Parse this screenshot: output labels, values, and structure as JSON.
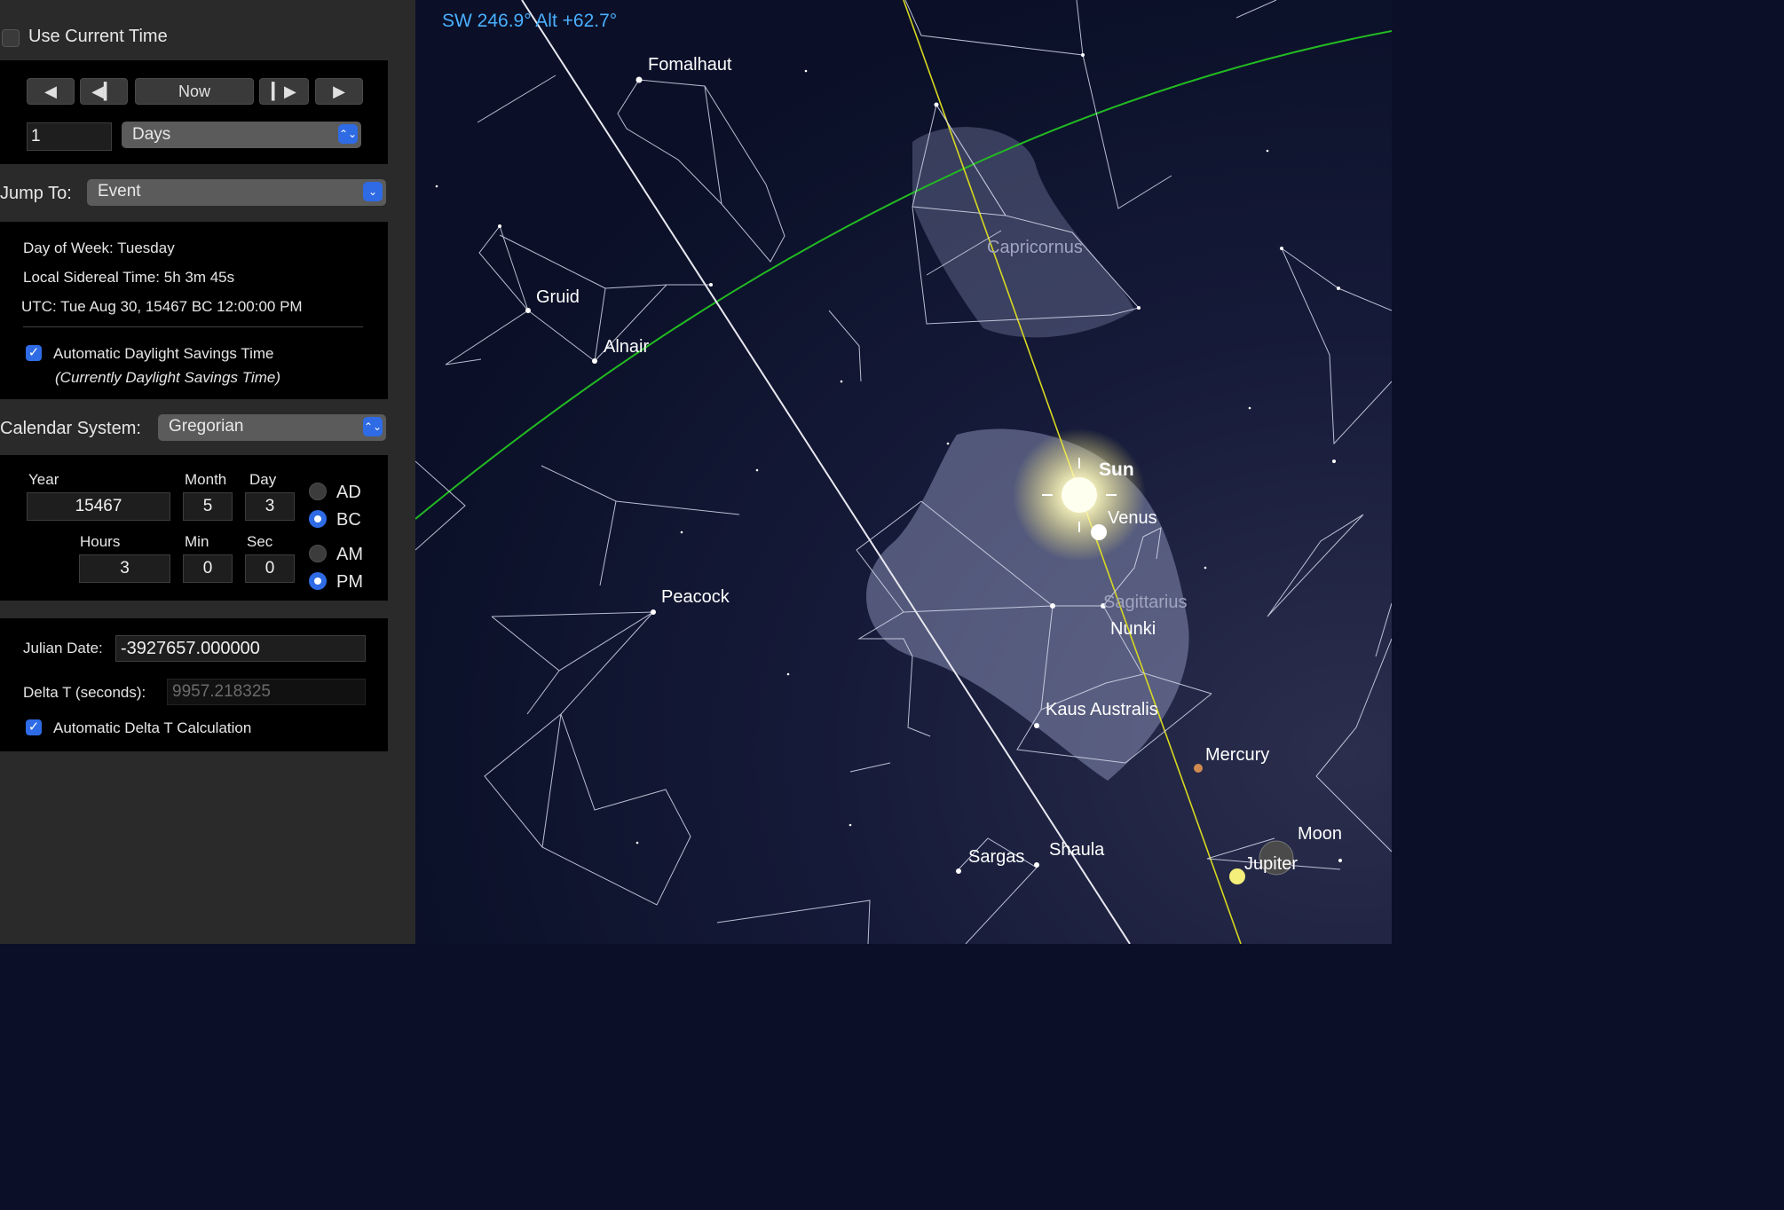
{
  "controls": {
    "use_current_time_label": "Use Current Time",
    "use_current_time_checked": false,
    "now_label": "Now",
    "step_value": "1",
    "step_unit": "Days",
    "jump_to_label": "Jump To:",
    "jump_to_value": "Event"
  },
  "info": {
    "day_of_week": "Day of Week:  Tuesday",
    "sidereal": "Local Sidereal Time:  5h 3m 45s",
    "utc": "UTC:  Tue Aug 30, 15467 BC 12:00:00 PM",
    "auto_dst_label": "Automatic Daylight Savings Time",
    "auto_dst_checked": true,
    "dst_note": "(Currently Daylight Savings Time)"
  },
  "calendar": {
    "label": "Calendar System:",
    "value": "Gregorian",
    "year_label": "Year",
    "year": "15467",
    "month_label": "Month",
    "month": "5",
    "day_label": "Day",
    "day": "3",
    "hours_label": "Hours",
    "hours": "3",
    "min_label": "Min",
    "min": "0",
    "sec_label": "Sec",
    "sec": "0",
    "ad_label": "AD",
    "bc_label": "BC",
    "era_selected": "BC",
    "am_label": "AM",
    "pm_label": "PM",
    "ampm_selected": "PM"
  },
  "julian": {
    "label": "Julian Date:",
    "value": "-3927657.000000",
    "delta_t_label": "Delta T (seconds):",
    "delta_t_value": "9957.218325",
    "auto_delta_label": "Automatic Delta T Calculation",
    "auto_delta_checked": true
  },
  "sky": {
    "direction": "SW 246.9° Alt +62.7°",
    "colors": {
      "ecliptic": "#22bb22",
      "meridian": "#d8d820",
      "direction_text": "#4ab0ff",
      "label": "#ffffff"
    },
    "star_labels": [
      "Fomalhaut",
      "Gruid",
      "Alnair",
      "Peacock",
      "Nunki",
      "Kaus Australis",
      "Sargas",
      "Shaula"
    ],
    "constellation_labels": [
      "Capricornus",
      "Sagittarius"
    ],
    "planet_labels": {
      "sun": "Sun",
      "venus": "Venus",
      "mercury": "Mercury",
      "moon": "Moon",
      "jupiter": "Jupiter"
    }
  }
}
